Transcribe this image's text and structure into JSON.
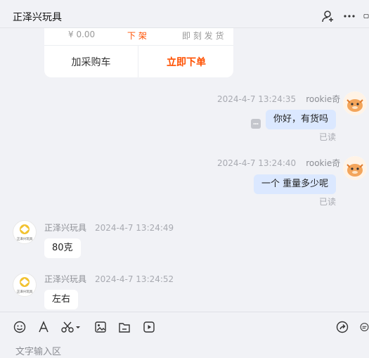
{
  "header": {
    "title": "正泽兴玩具"
  },
  "product_card": {
    "cut_labels": [
      "¥ 0.00",
      "下 架",
      "即 刻 发 货"
    ],
    "add_button": "加采购车",
    "order_button": "立即下单"
  },
  "messages": [
    {
      "side": "out",
      "time": "2024-4-7 13:24:35",
      "sender": "rookie奇",
      "text": "你好，有货吗",
      "status": "已读"
    },
    {
      "side": "out",
      "time": "2024-4-7 13:24:40",
      "sender": "rookie奇",
      "text": "一个 重量多少呢",
      "status": "已读"
    },
    {
      "side": "in",
      "time": "2024-4-7 13:24:49",
      "sender": "正泽兴玩具",
      "text": "80克"
    },
    {
      "side": "in",
      "time": "2024-4-7 13:24:52",
      "sender": "正泽兴玩具",
      "text": "左右"
    }
  ],
  "avatar_logo_text": "正泽兴玩具",
  "toolbar": {
    "icons": [
      "emoji-icon",
      "font-icon",
      "scissors-icon",
      "image-icon",
      "folder-icon",
      "video-icon",
      "share-icon",
      "quick-reply-icon"
    ]
  },
  "input": {
    "placeholder": "文字输入区"
  },
  "colors": {
    "accent": "#ff5000",
    "out_bubble": "#dbe8ff",
    "background": "#f1f2f6"
  }
}
